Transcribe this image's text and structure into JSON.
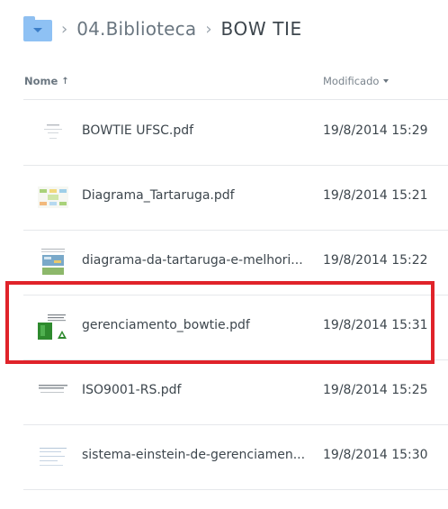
{
  "breadcrumb": {
    "parent": "04.Biblioteca",
    "current": "BOW TIE",
    "separator": "›"
  },
  "header": {
    "name_label": "Nome",
    "name_sort_icon": "arrow-up-icon",
    "modified_label": "Modificado",
    "modified_sort_icon": "caret-down-icon"
  },
  "files": [
    {
      "name": "BOWTIE UFSC.pdf",
      "modified": "19/8/2014 15:29",
      "thumbnail": "pdf-thumbnail-icon"
    },
    {
      "name": "Diagrama_Tartaruga.pdf",
      "modified": "19/8/2014 15:21",
      "thumbnail": "pdf-thumbnail-icon"
    },
    {
      "name": "diagrama-da-tartaruga-e-melhori...",
      "modified": "19/8/2014 15:22",
      "thumbnail": "pdf-thumbnail-icon"
    },
    {
      "name": "gerenciamento_bowtie.pdf",
      "modified": "19/8/2014 15:31",
      "thumbnail": "pdf-thumbnail-icon"
    },
    {
      "name": "ISO9001-RS.pdf",
      "modified": "19/8/2014 15:25",
      "thumbnail": "pdf-thumbnail-icon"
    },
    {
      "name": "sistema-einstein-de-gerenciamen...",
      "modified": "19/8/2014 15:30",
      "thumbnail": "pdf-thumbnail-icon"
    }
  ],
  "colors": {
    "text": "#3d464d",
    "muted": "#6a7680",
    "folder": "#8ec1f4",
    "highlight": "#e0232a",
    "divider": "#e6e8eb"
  }
}
